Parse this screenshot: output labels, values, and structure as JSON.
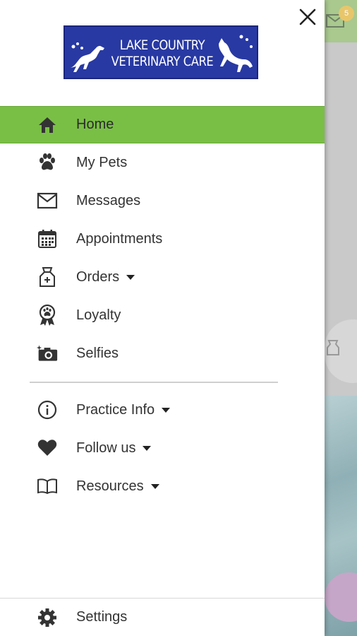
{
  "drawer": {
    "logo": {
      "line1": "LAKE COUNTRY",
      "line2": "VETERINARY CARE",
      "color": "#2839a3"
    },
    "close_icon": "close-icon",
    "active_color": "#79bf45",
    "primary_items": [
      {
        "label": "Home",
        "icon": "home-icon",
        "active": true
      },
      {
        "label": "My Pets",
        "icon": "paw-icon"
      },
      {
        "label": "Messages",
        "icon": "envelope-icon"
      },
      {
        "label": "Appointments",
        "icon": "calendar-icon"
      },
      {
        "label": "Orders",
        "icon": "food-bag-icon",
        "has_dropdown": true
      },
      {
        "label": "Loyalty",
        "icon": "loyalty-badge-icon"
      },
      {
        "label": "Selfies",
        "icon": "camera-icon"
      }
    ],
    "secondary_items": [
      {
        "label": "Practice Info",
        "icon": "info-icon",
        "has_dropdown": true
      },
      {
        "label": "Follow us",
        "icon": "heart-icon",
        "has_dropdown": true
      },
      {
        "label": "Resources",
        "icon": "book-icon",
        "has_dropdown": true
      }
    ],
    "footer": {
      "label": "Settings",
      "icon": "gear-icon"
    }
  },
  "background": {
    "badge_count": "5"
  }
}
